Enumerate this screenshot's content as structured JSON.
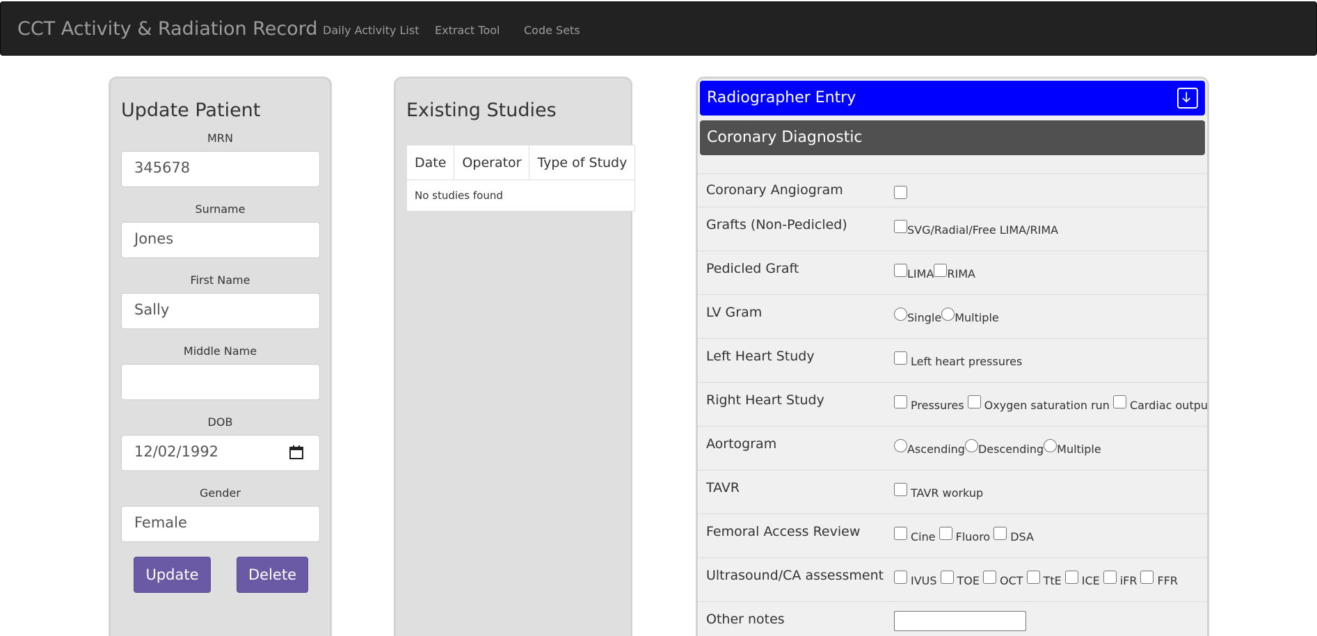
{
  "navbar": {
    "brand": "CCT Activity & Radiation Record",
    "links": [
      "Daily Activity List",
      "Extract Tool",
      "Code Sets"
    ]
  },
  "update_patient": {
    "title": "Update Patient",
    "fields": {
      "mrn": {
        "label": "MRN",
        "value": "345678"
      },
      "surname": {
        "label": "Surname",
        "value": "Jones"
      },
      "first_name": {
        "label": "First Name",
        "value": "Sally"
      },
      "middle_name": {
        "label": "Middle Name",
        "value": ""
      },
      "dob": {
        "label": "DOB",
        "value": "12/02/1992"
      },
      "gender": {
        "label": "Gender",
        "value": "Female"
      }
    },
    "update_label": "Update",
    "delete_label": "Delete"
  },
  "existing_studies": {
    "title": "Existing Studies",
    "columns": [
      "Date",
      "Operator",
      "Type of Study"
    ],
    "empty_text": "No studies found"
  },
  "radiographer": {
    "header": "Radiographer Entry",
    "section": "Coronary Diagnostic",
    "rows": [
      {
        "label": "Coronary Angiogram",
        "options": []
      },
      {
        "label": "Grafts (Non-Pedicled)",
        "options": [
          "SVG/Radial/Free LIMA/RIMA"
        ]
      },
      {
        "label": "Pedicled Graft",
        "options": [
          "LIMA",
          "RIMA"
        ]
      },
      {
        "label": "LV Gram",
        "options": [
          "Single",
          "Multiple"
        ]
      },
      {
        "label": "Left Heart Study",
        "options": [
          "Left heart pressures"
        ]
      },
      {
        "label": "Right Heart Study",
        "options": [
          "Pressures",
          "Oxygen saturation run",
          "Cardiac output"
        ]
      },
      {
        "label": "Aortogram",
        "options": [
          "Ascending",
          "Descending",
          "Multiple"
        ]
      },
      {
        "label": "TAVR",
        "options": [
          "TAVR workup"
        ]
      },
      {
        "label": "Femoral Access Review",
        "options": [
          "Cine",
          "Fluoro",
          "DSA"
        ]
      },
      {
        "label": "Ultrasound/CA assessment",
        "options": [
          "IVUS",
          "TOE",
          "OCT",
          "TtE",
          "ICE",
          "iFR",
          "FFR"
        ]
      },
      {
        "label": "Other notes",
        "options": []
      }
    ]
  }
}
